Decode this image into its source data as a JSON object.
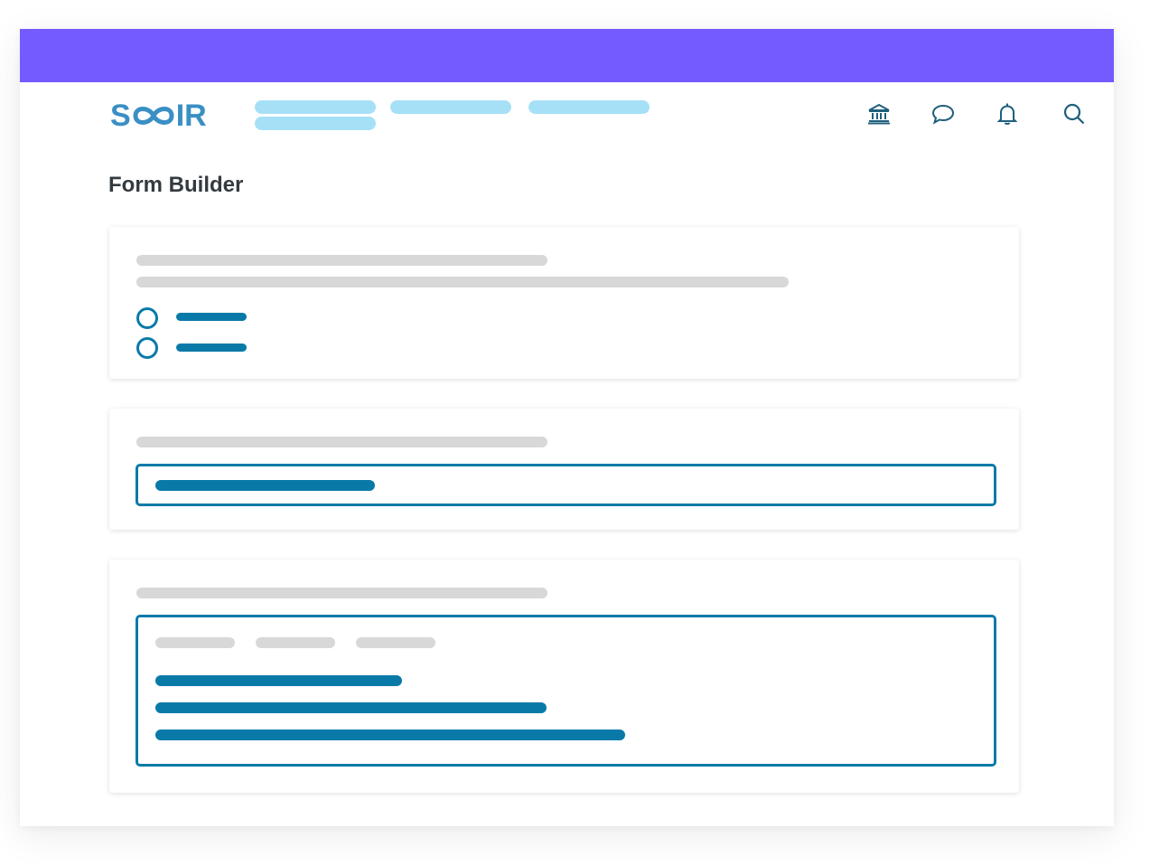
{
  "app": {
    "brand": {
      "prefix": "S",
      "suffix": "IR"
    },
    "page_title": "Form Builder"
  },
  "colors": {
    "topbar": "#745bff",
    "logo": "#3a8fc4",
    "nav_skeleton": "#a6e0f7",
    "accent": "#097aa8",
    "skeleton_gray": "#d8d8d8",
    "icon": "#1f5f7d"
  },
  "header": {
    "nav_placeholder_count": 4,
    "icons": [
      "institution-icon",
      "chat-icon",
      "bell-icon",
      "search-icon"
    ]
  },
  "cards": [
    {
      "type": "multiple-choice",
      "option_count": 2
    },
    {
      "type": "short-text",
      "has_value": true
    },
    {
      "type": "rich-text",
      "toolbar_item_count": 3,
      "line_count": 3
    }
  ]
}
